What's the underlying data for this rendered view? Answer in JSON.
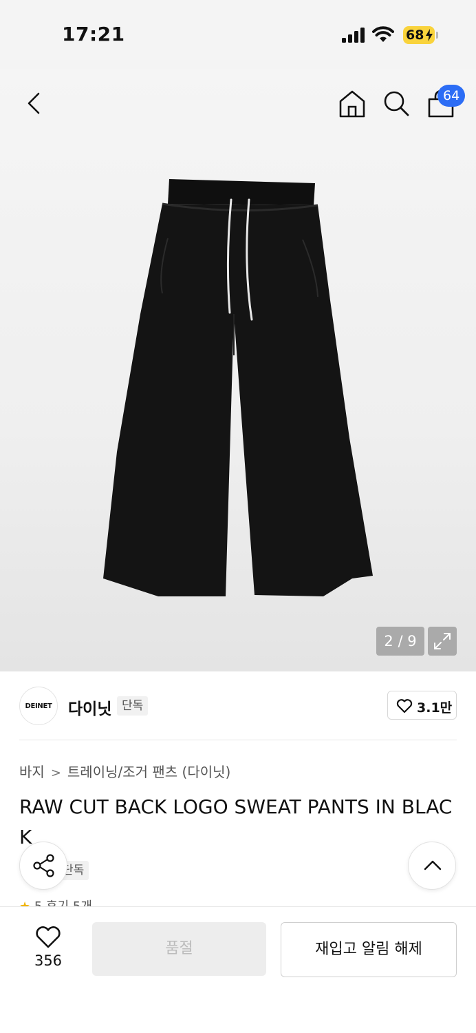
{
  "status_bar": {
    "time": "17:21",
    "battery": "68"
  },
  "header": {
    "cart_count": "64"
  },
  "gallery": {
    "page_counter": "2 / 9"
  },
  "brand": {
    "logo_text": "DEINET",
    "name": "다이닛",
    "exclusive_tag": "단독",
    "like_count": "3.1만"
  },
  "breadcrumb": {
    "category": "바지",
    "subcategory": "트레이닝/조거 팬츠 (다이닛)"
  },
  "product": {
    "title": "RAW CUT BACK LOGO SWEAT PANTS IN BLACK",
    "exclusive_tag": "단독",
    "rating_star": "★",
    "rating_text": "5  후기 5개"
  },
  "bottom_bar": {
    "wish_count": "356",
    "soldout_label": "품절",
    "restock_label": "재입고 알림 해제"
  },
  "colors": {
    "accent_blue": "#2c6df5",
    "battery_yellow": "#f9d33c",
    "star": "#f0b400"
  },
  "icons": [
    "signal-icon",
    "wifi-icon",
    "battery-icon",
    "back-arrow-icon",
    "home-icon",
    "search-icon",
    "shopping-bag-icon",
    "expand-icon",
    "heart-icon",
    "share-icon",
    "chevron-up-icon"
  ]
}
